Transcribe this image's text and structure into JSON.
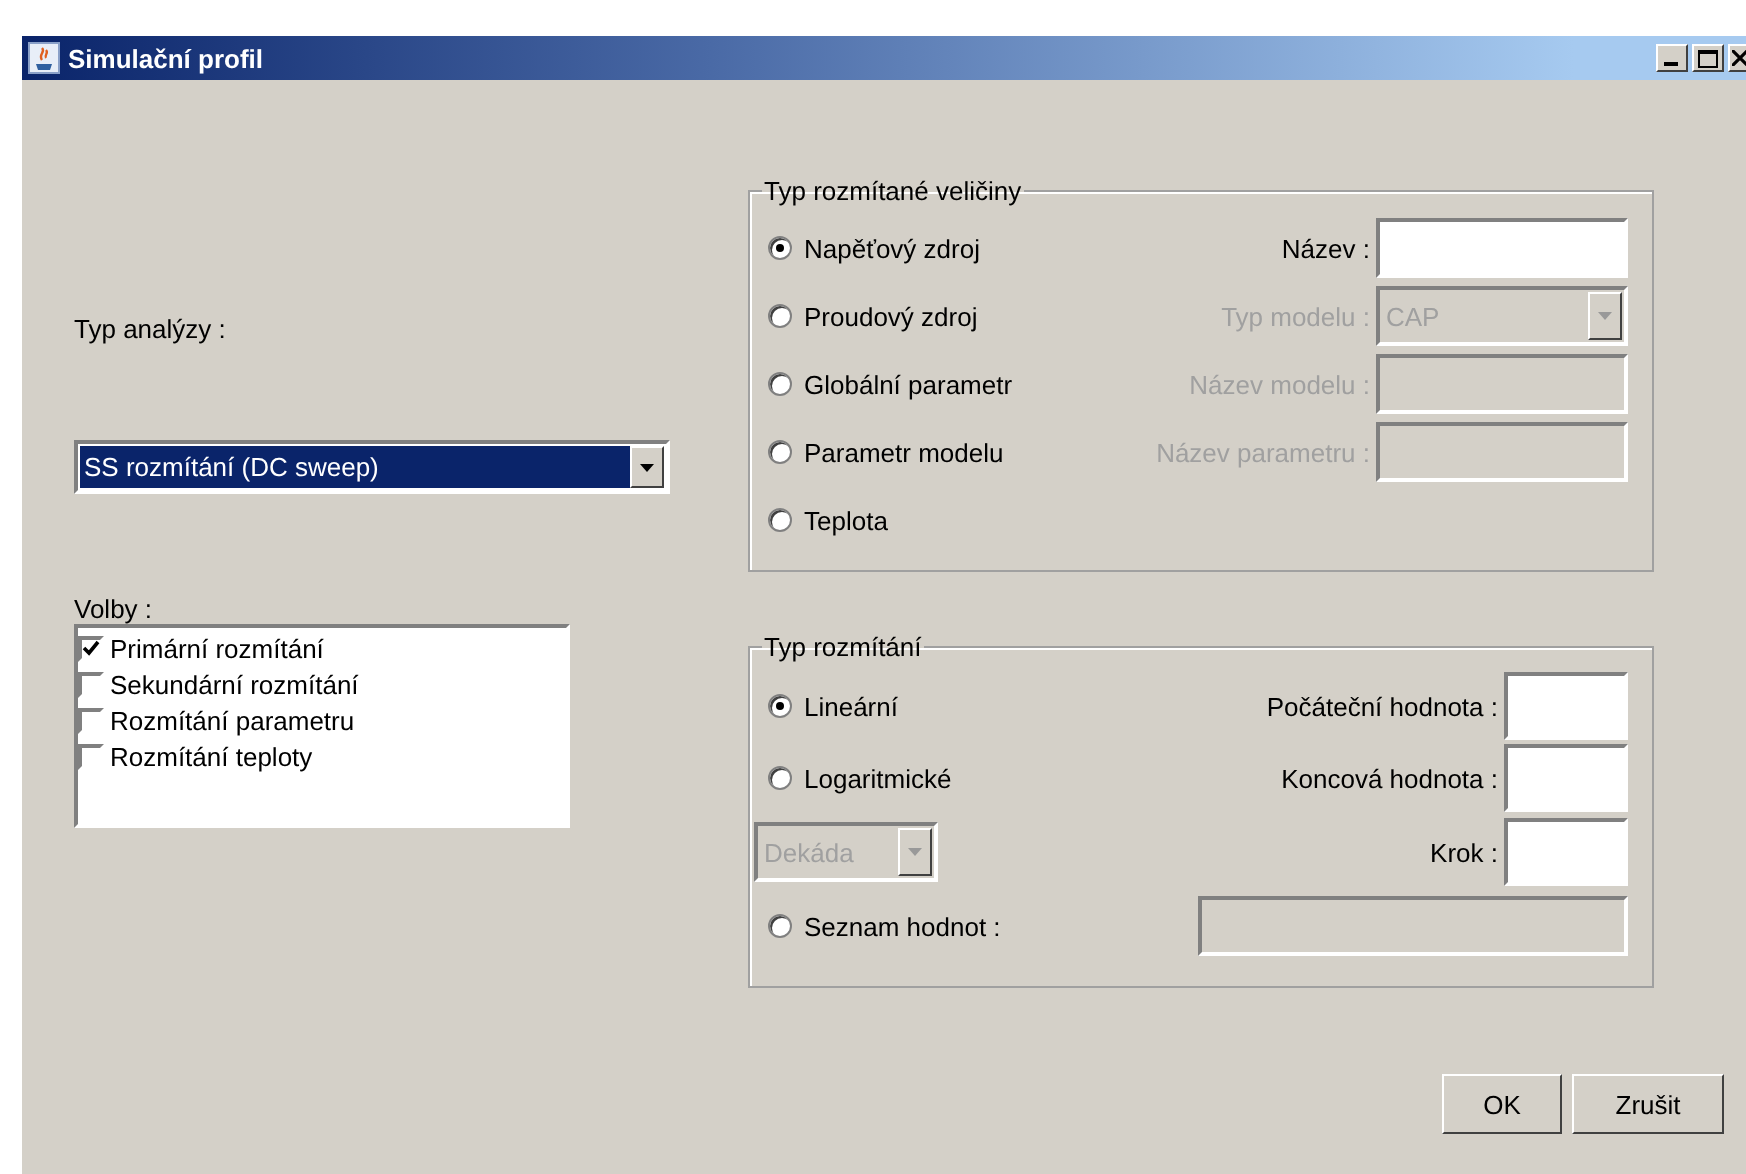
{
  "window": {
    "title": "Simulační profil"
  },
  "analysis": {
    "label": "Typ analýzy :",
    "value": "SS rozmítání (DC sweep)",
    "highlighted": true
  },
  "options": {
    "label": "Volby :",
    "items": [
      {
        "label": "Primární rozmítání",
        "checked": true
      },
      {
        "label": "Sekundární rozmítání",
        "checked": false
      },
      {
        "label": "Rozmítání parametru",
        "checked": false
      },
      {
        "label": "Rozmítání teploty",
        "checked": false
      }
    ]
  },
  "sweep_variable": {
    "title": "Typ rozmítané veličiny",
    "rows": [
      {
        "left": {
          "kind": "radio",
          "label": "Napěťový zdroj",
          "selected": true
        },
        "field": {
          "kind": "text",
          "label": "Název :",
          "disabled": false
        }
      },
      {
        "left": {
          "kind": "radio",
          "label": "Proudový zdroj",
          "selected": false
        },
        "field": {
          "kind": "combo",
          "label": "Typ modelu :",
          "value": "CAP",
          "disabled": true
        }
      },
      {
        "left": {
          "kind": "radio",
          "label": "Globální parametr",
          "selected": false
        },
        "field": {
          "kind": "text",
          "label": "Název modelu :",
          "disabled": true
        }
      },
      {
        "left": {
          "kind": "radio",
          "label": "Parametr modelu",
          "selected": false
        },
        "field": {
          "kind": "text",
          "label": "Název parametru :",
          "disabled": true
        }
      },
      {
        "left": {
          "kind": "radio",
          "label": "Teplota",
          "selected": false
        }
      }
    ]
  },
  "sweep_type": {
    "title": "Typ rozmítání",
    "rows": [
      {
        "left": {
          "kind": "radio",
          "label": "Lineární",
          "selected": true
        },
        "field": {
          "kind": "small",
          "label": "Počáteční hodnota :",
          "disabled": false
        }
      },
      {
        "left": {
          "kind": "radio",
          "label": "Logaritmické",
          "selected": false
        },
        "field": {
          "kind": "small",
          "label": "Koncová hodnota :",
          "disabled": false
        }
      },
      {
        "left": {
          "kind": "combo",
          "value": "Dekáda",
          "disabled": true
        },
        "field": {
          "kind": "small",
          "label": "Krok :",
          "disabled": false
        }
      },
      {
        "left": {
          "kind": "radio",
          "label": "Seznam hodnot :",
          "selected": false
        },
        "field": {
          "kind": "wide",
          "disabled": true
        }
      }
    ]
  },
  "buttons": [
    "OK",
    "Zrušit"
  ]
}
